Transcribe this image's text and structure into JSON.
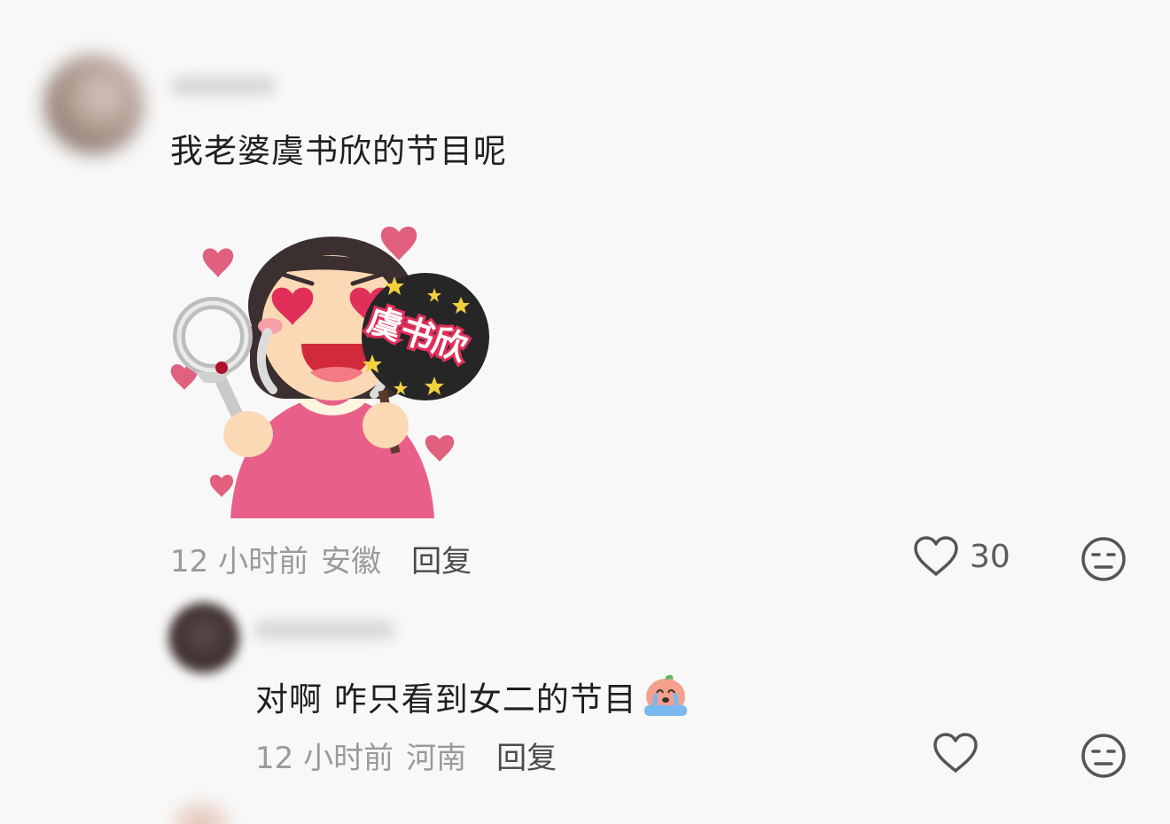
{
  "comments": [
    {
      "text": "我老婆虞书欣的节目呢",
      "time": "12 小时前",
      "location": "安徽",
      "reply_label": "回复",
      "likes": "30",
      "sticker_text": "虞书欣"
    },
    {
      "text": "对啊 咋只看到女二的节目",
      "time": "12 小时前",
      "location": "河南",
      "reply_label": "回复",
      "likes": ""
    }
  ],
  "colors": {
    "background": "#f8f8f8",
    "text": "#1f1f1f",
    "meta": "#9a9a9a",
    "heart": "#e0607e",
    "shirt": "#e8608a"
  },
  "icons": [
    "heart-outline-icon",
    "meh-face-icon",
    "crying-peach-emoji"
  ]
}
